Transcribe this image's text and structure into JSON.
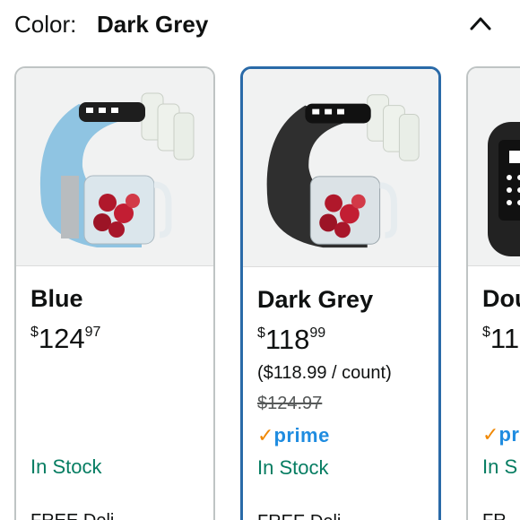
{
  "header": {
    "color_label": "Color:",
    "selected_color": "Dark Grey",
    "collapse_icon": "chevron-up-icon"
  },
  "options": [
    {
      "name": "Blue",
      "price_symbol": "$",
      "price_whole": "124",
      "price_fraction": "97",
      "stock": "In Stock",
      "delivery": "FREE Deli",
      "body_color": "#8fc4e2",
      "selected": false
    },
    {
      "name": "Dark Grey",
      "price_symbol": "$",
      "price_whole": "118",
      "price_fraction": "99",
      "unit_price": "($118.99 / count)",
      "list_price": "$124.97",
      "prime": "prime",
      "stock": "In Stock",
      "delivery": "FREE Deli",
      "body_color": "#2f2f2f",
      "selected": true
    },
    {
      "name": "Dou",
      "price_symbol": "$",
      "price_whole": "11",
      "prime": "pri",
      "stock": "In S",
      "delivery": "FR",
      "body_color": "#222222",
      "selected": false
    }
  ],
  "colors": {
    "selected_border": "#2a6aa8",
    "stock_green": "#067d62",
    "prime_blue": "#1f8ce0",
    "prime_orange": "#f08804"
  }
}
